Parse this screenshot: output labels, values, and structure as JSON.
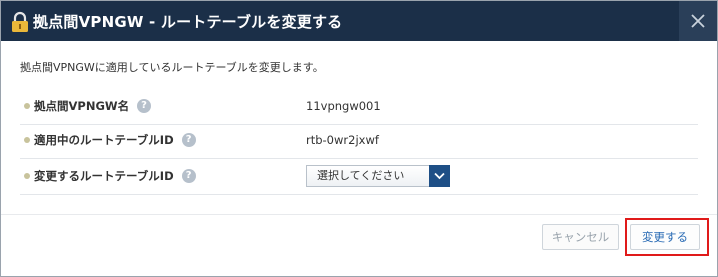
{
  "dialog": {
    "title": "拠点間VPNGW - ルートテーブルを変更する",
    "title_icon": "lock-icon",
    "close_icon": "close-icon",
    "description": "拠点間VPNGWに適用しているルートテーブルを変更します。"
  },
  "fields": {
    "gateway": {
      "label": "拠点間VPNGW名",
      "help": "?",
      "value": "11vpngw001"
    },
    "current_table": {
      "label": "適用中のルートテーブルID",
      "help": "?",
      "value": "rtb-0wr2jxwf"
    },
    "new_table": {
      "label": "変更するルートテーブルID",
      "help": "?",
      "selected": "選択してください"
    }
  },
  "buttons": {
    "cancel": "キャンセル",
    "change": "変更する"
  },
  "colors": {
    "titlebar": "#1b2f48",
    "select_accent": "#1e4f86",
    "highlight": "#e01a1a",
    "link_text": "#2b6cb5"
  }
}
